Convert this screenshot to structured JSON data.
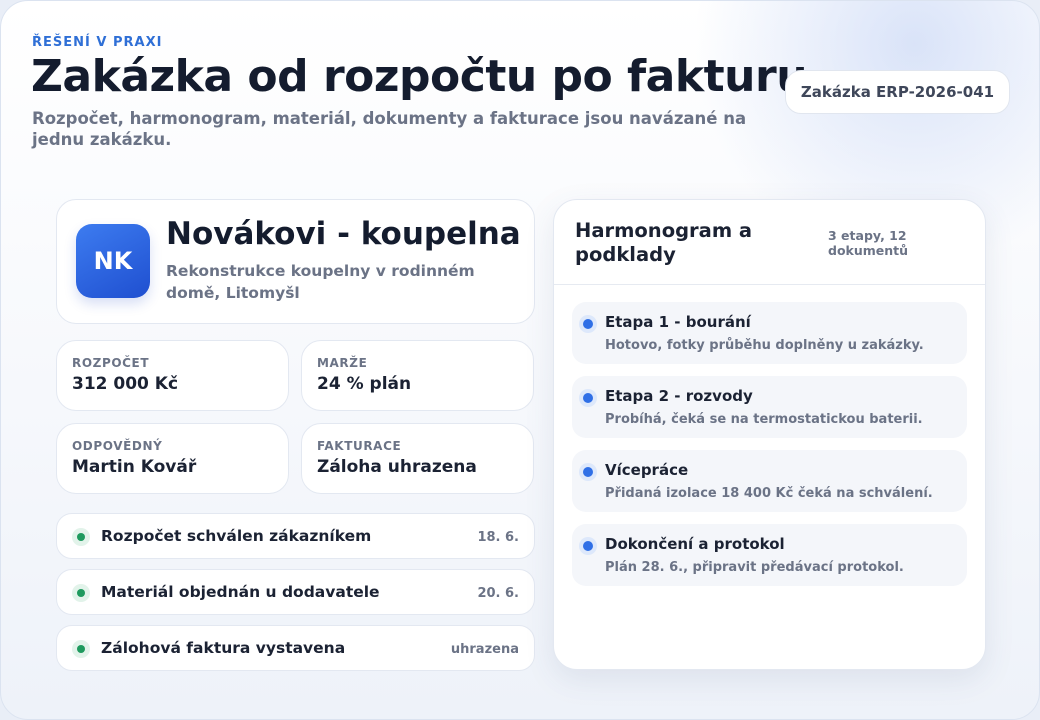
{
  "header": {
    "eyebrow": "ŘEŠENÍ V PRAXI",
    "title": "Zakázka od rozpočtu po fakturu",
    "subtitle": "Rozpočet, harmonogram, materiál, dokumenty a fakturace jsou navázané na jednu zakázku.",
    "order_badge": "Zakázka ERP-2026-041"
  },
  "project": {
    "initials": "NK",
    "name": "Novákovi - koupelna",
    "description": "Rekonstrukce koupelny v rodinném domě, Litomyšl",
    "accent_color": "#2f62e0"
  },
  "stats": [
    {
      "label": "ROZPOČET",
      "value": "312 000 Kč"
    },
    {
      "label": "MARŽE",
      "value": "24 % plán"
    },
    {
      "label": "ODPOVĚDNÝ",
      "value": "Martin Kovář"
    },
    {
      "label": "FAKTURACE",
      "value": "Záloha uhrazena"
    }
  ],
  "milestones": [
    {
      "label": "Rozpočet schválen zákazníkem",
      "meta": "18. 6.",
      "icon": "check-dot-icon"
    },
    {
      "label": "Materiál objednán u dodavatele",
      "meta": "20. 6.",
      "icon": "check-dot-icon"
    },
    {
      "label": "Zálohová faktura vystavena",
      "meta": "uhrazena",
      "icon": "check-dot-icon"
    }
  ],
  "schedule": {
    "title": "Harmonogram a podklady",
    "meta": "3 etapy, 12 dokumentů",
    "steps": [
      {
        "title": "Etapa 1 - bourání",
        "description": "Hotovo, fotky průběhu doplněny u zakázky."
      },
      {
        "title": "Etapa 2 - rozvody",
        "description": "Probíhá, čeká se na termostatickou baterii."
      },
      {
        "title": "Vícepráce",
        "description": "Přidaná izolace 18 400 Kč čeká na schválení."
      },
      {
        "title": "Dokončení a protokol",
        "description": "Plán 28. 6., připravit předávací protokol."
      }
    ]
  },
  "colors": {
    "accent": "#2f6fd6",
    "success": "#1f9a5e",
    "text": "#141c2e",
    "muted": "#6b7386"
  }
}
